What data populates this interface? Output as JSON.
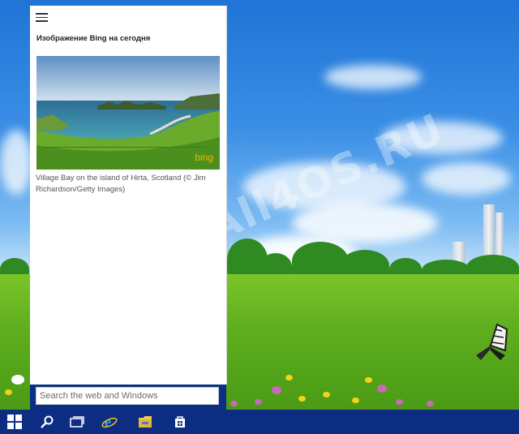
{
  "watermark": "All4OS.RU",
  "cortana_panel": {
    "menu_icon": "hamburger-menu-icon",
    "title": "Изображение Bing на сегодня",
    "image": {
      "description_icon": "bing-image",
      "logo_text": "bing"
    },
    "caption": "Village Bay on the island of Hirta, Scotland (© Jim Richardson/Getty Images)"
  },
  "search": {
    "placeholder": "Search the web and Windows",
    "value": ""
  },
  "taskbar": {
    "items": [
      {
        "name": "start",
        "icon": "windows-logo-icon"
      },
      {
        "name": "search",
        "icon": "search-icon"
      },
      {
        "name": "task-view",
        "icon": "task-view-icon"
      },
      {
        "name": "internet-explorer",
        "icon": "internet-explorer-icon"
      },
      {
        "name": "file-explorer",
        "icon": "folder-icon"
      },
      {
        "name": "store",
        "icon": "store-icon"
      }
    ]
  },
  "colors": {
    "taskbar": "#0c2d82",
    "search_area": "#0b2e86",
    "panel_bg": "#ffffff",
    "bing_logo": "#f5b400"
  }
}
